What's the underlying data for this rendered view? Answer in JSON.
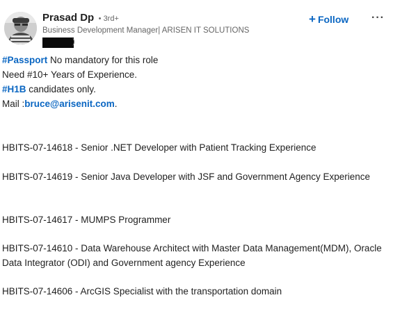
{
  "author": {
    "name": "Prasad Dp",
    "degree": "• 3rd+",
    "headline": "Business Development Manager| ARISEN IT SOLUTIONS",
    "redacted_tail": ")"
  },
  "actions": {
    "follow_plus": "+",
    "follow_label": "Follow",
    "more_label": "···"
  },
  "post": {
    "line1": {
      "hashtag": "#Passport",
      "text": " No mandatory for this role"
    },
    "line2": {
      "text": "Need #10+ Years of Experience."
    },
    "line3": {
      "hashtag": "#H1B",
      "text": " candidates only."
    },
    "line4": {
      "prefix": "Mail :",
      "email": "bruce@arisenit.com",
      "suffix": "."
    },
    "jobs": [
      "HBITS-07-14618 - Senior .NET Developer with Patient Tracking Experience",
      "HBITS-07-14619 - Senior Java Developer with JSF and Government Agency Experience",
      "HBITS-07-14617 - MUMPS Programmer",
      "HBITS-07-14610 - Data Warehouse Architect with Master Data Management(MDM), Oracle Data Integrator (ODI) and Government agency Experience",
      "HBITS-07-14606 - ArcGIS Specialist with the transportation domain"
    ]
  },
  "colors": {
    "link": "#0a66c2",
    "text": "#1f1f1f",
    "muted": "#666666",
    "background": "#ffffff"
  }
}
